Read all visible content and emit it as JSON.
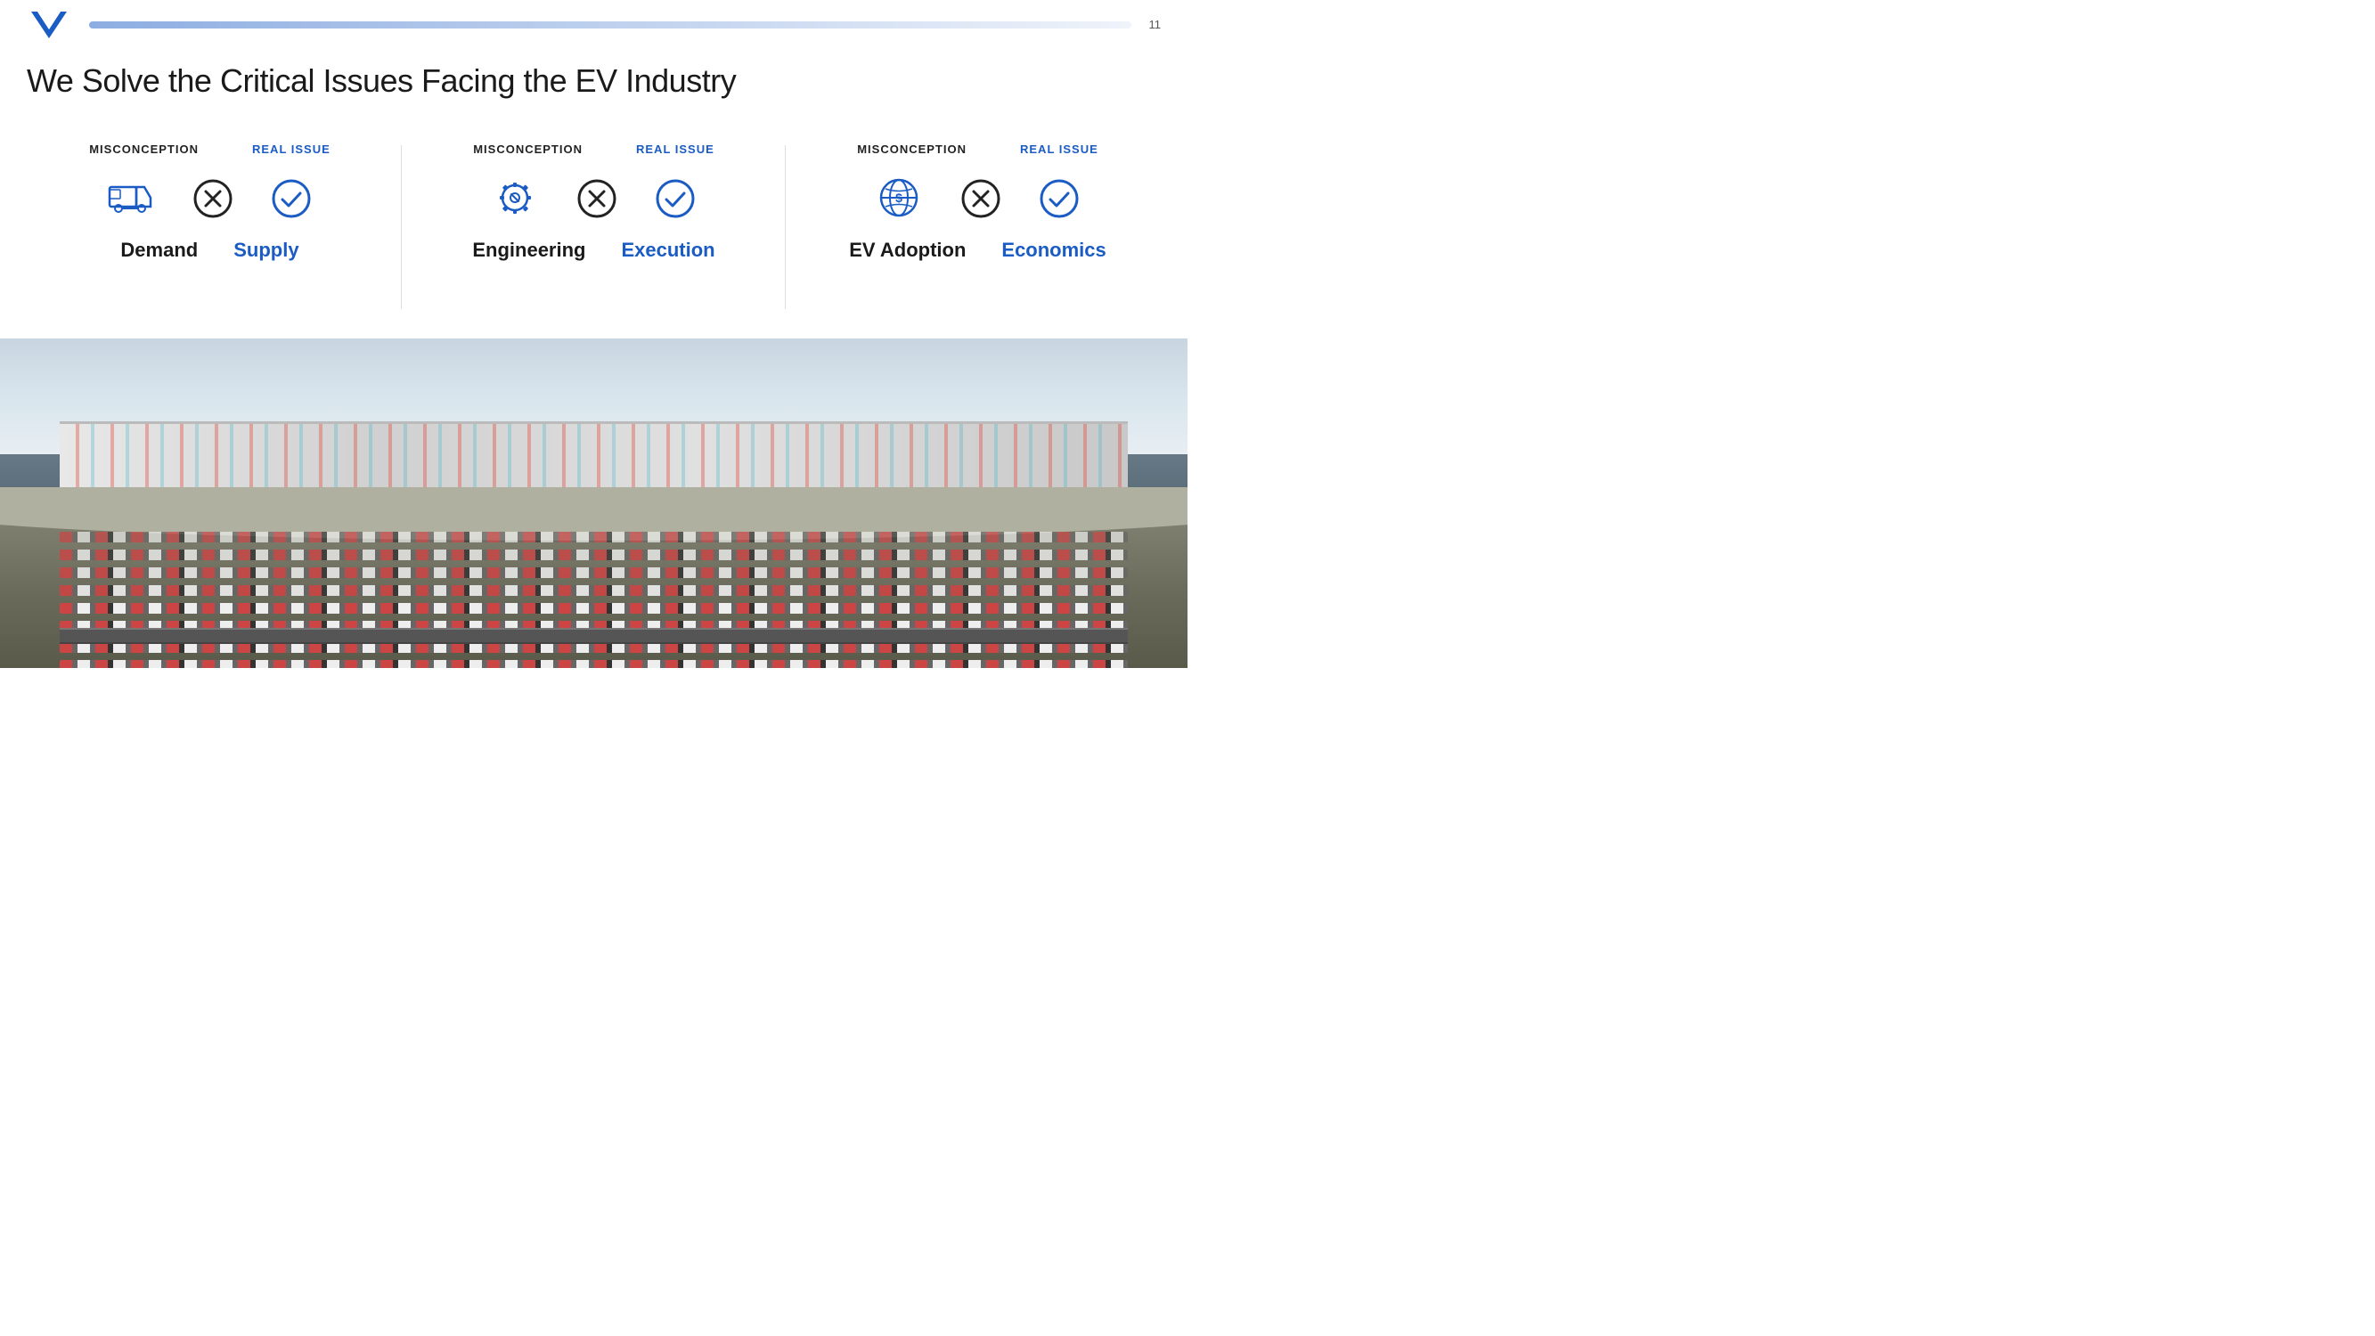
{
  "page": {
    "number": "11",
    "title": "We Solve the Critical Issues Facing the EV Industry"
  },
  "header": {
    "logo_alt": "VinFast Logo"
  },
  "columns": [
    {
      "id": "demand-supply",
      "misconception_label": "MISCONCEPTION",
      "real_issue_label": "REAL ISSUE",
      "main_icon": "truck-icon",
      "item_dark": "Demand",
      "item_blue": "Supply"
    },
    {
      "id": "engineering-execution",
      "misconception_label": "MISCONCEPTION",
      "real_issue_label": "REAL ISSUE",
      "main_icon": "gear-wrench-icon",
      "item_dark": "Engineering",
      "item_blue": "Execution"
    },
    {
      "id": "ev-adoption-economics",
      "misconception_label": "MISCONCEPTION",
      "real_issue_label": "REAL ISSUE",
      "main_icon": "globe-dollar-icon",
      "item_dark": "EV Adoption",
      "item_blue": "Economics"
    }
  ],
  "colors": {
    "blue": "#1a5bc4",
    "dark": "#1a1a1a",
    "border": "#dddddd"
  }
}
